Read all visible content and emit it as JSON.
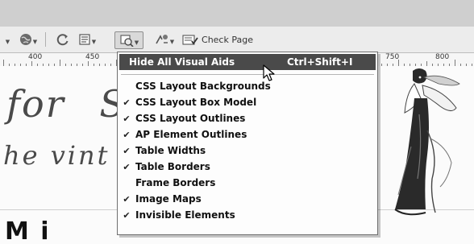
{
  "toolbar": {
    "check_page_label": "Check Page",
    "icons": [
      "globe-icon",
      "refresh-icon",
      "view-options-icon",
      "visual-aids-icon",
      "validate-icon",
      "check-page-icon"
    ]
  },
  "ruler": {
    "labels": [
      "400",
      "450",
      "750",
      "800"
    ]
  },
  "canvas": {
    "heading_line1": "for",
    "heading_line1_tail": "S",
    "heading_line2": "he vint",
    "bottom_text": "M i"
  },
  "menu": {
    "items": [
      {
        "label": "Hide All Visual Aids",
        "shortcut": "Ctrl+Shift+I",
        "checked": false,
        "highlighted": true
      },
      {
        "label": "CSS Layout Backgrounds",
        "checked": false
      },
      {
        "label": "CSS Layout Box Model",
        "checked": true
      },
      {
        "label": "CSS Layout Outlines",
        "checked": true
      },
      {
        "label": "AP Element Outlines",
        "checked": true
      },
      {
        "label": "Table Widths",
        "checked": true
      },
      {
        "label": "Table Borders",
        "checked": true
      },
      {
        "label": "Frame Borders",
        "checked": false
      },
      {
        "label": "Image Maps",
        "checked": true
      },
      {
        "label": "Invisible Elements",
        "checked": true
      }
    ],
    "check_glyph": "✔"
  },
  "colors": {
    "highlight": "#4a4a4a",
    "toolbar_bg": "#ececec",
    "titlebar_bg": "#cfcfcf"
  }
}
